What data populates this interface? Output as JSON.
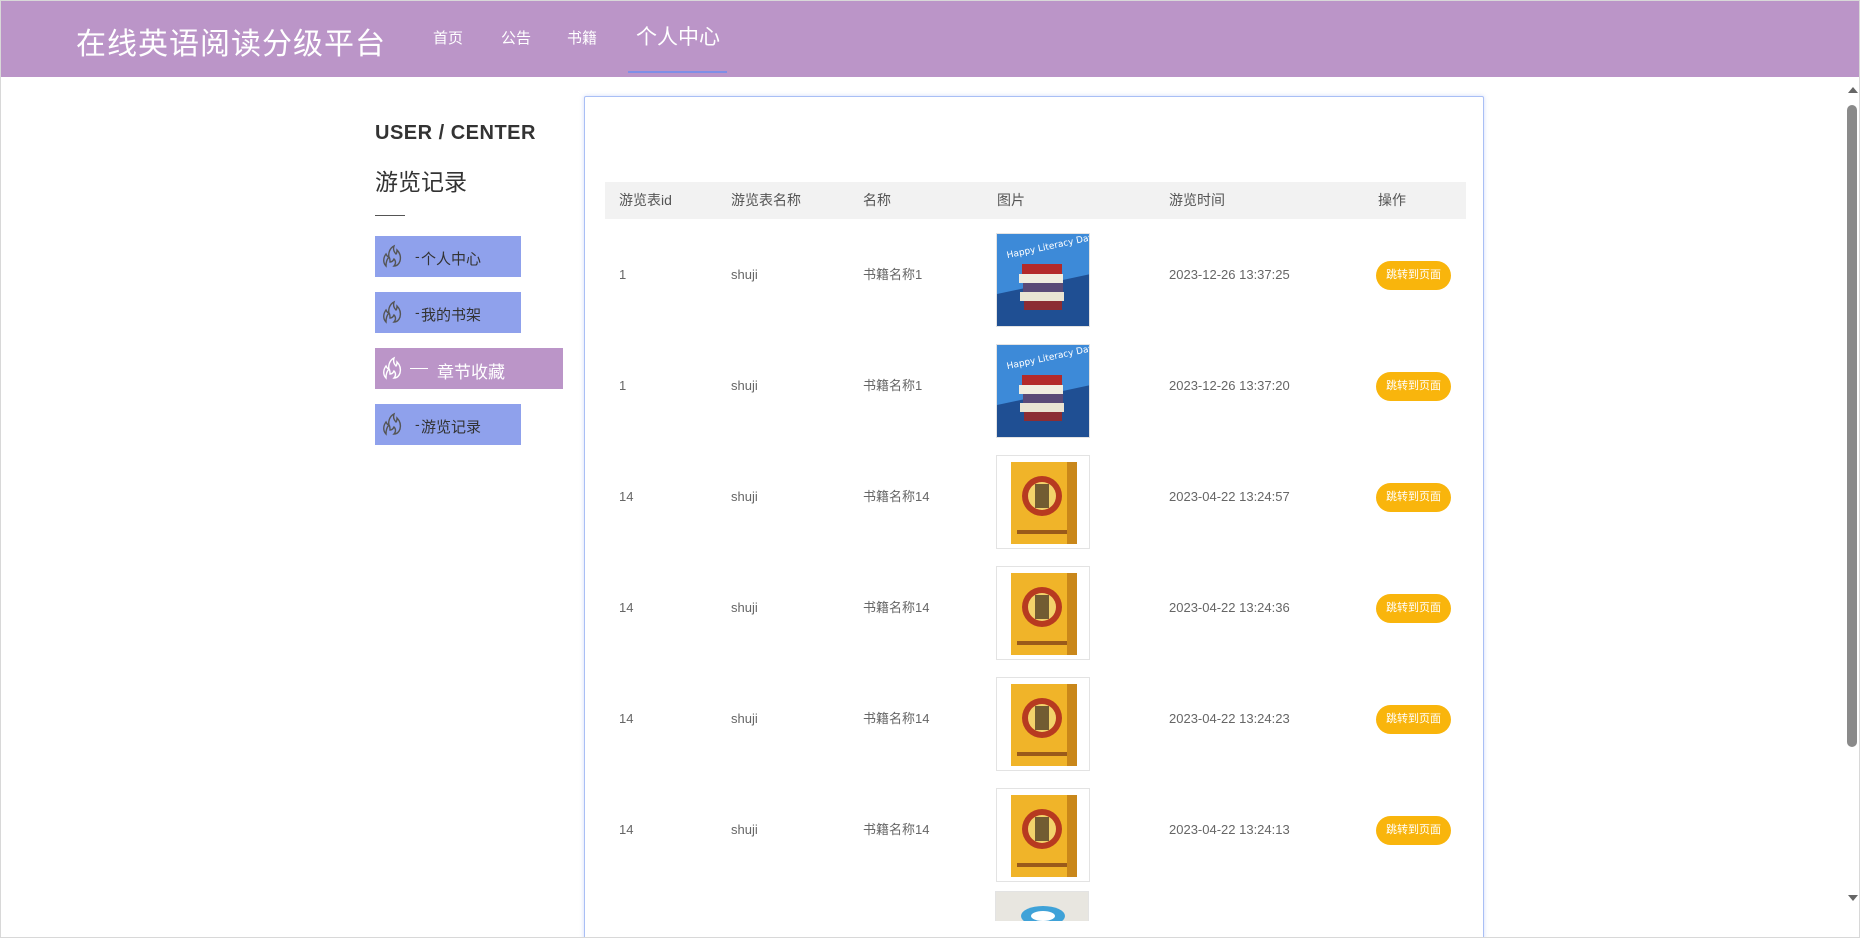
{
  "header": {
    "brand": "在线英语阅读分级平台",
    "nav": [
      {
        "label": "首页"
      },
      {
        "label": "公告"
      },
      {
        "label": "书籍"
      },
      {
        "label": "个人中心",
        "active": true
      }
    ]
  },
  "sidebar": {
    "title_en": "USER / CENTER",
    "title_cn": "游览记录",
    "items": [
      {
        "label": "个人中心",
        "icon": "fire-icon"
      },
      {
        "label": "我的书架",
        "icon": "fire-icon"
      },
      {
        "label": "章节收藏",
        "icon": "fire-icon",
        "active": true
      },
      {
        "label": "游览记录",
        "icon": "fire-icon"
      }
    ],
    "dash": "-"
  },
  "table": {
    "columns": [
      "游览表id",
      "游览表名称",
      "名称",
      "图片",
      "游览时间",
      "操作"
    ],
    "action_label": "跳转到页面",
    "rows": [
      {
        "id": "1",
        "table_name": "shuji",
        "name": "书籍名称1",
        "image": "red-book-stack",
        "time": "2023-12-26 13:37:25"
      },
      {
        "id": "1",
        "table_name": "shuji",
        "name": "书籍名称1",
        "image": "red-book-stack",
        "time": "2023-12-26 13:37:20"
      },
      {
        "id": "14",
        "table_name": "shuji",
        "name": "书籍名称14",
        "image": "yellow-book-cover",
        "time": "2023-04-22 13:24:57"
      },
      {
        "id": "14",
        "table_name": "shuji",
        "name": "书籍名称14",
        "image": "yellow-book-cover",
        "time": "2023-04-22 13:24:36"
      },
      {
        "id": "14",
        "table_name": "shuji",
        "name": "书籍名称14",
        "image": "yellow-book-cover",
        "time": "2023-04-22 13:24:23"
      },
      {
        "id": "14",
        "table_name": "shuji",
        "name": "书籍名称14",
        "image": "yellow-book-cover",
        "time": "2023-04-22 13:24:13"
      }
    ]
  },
  "colors": {
    "header_bg": "#bb95c8",
    "menu_bg": "#8fa1ec",
    "menu_active_bg": "#bb95c8",
    "button_bg": "#f9b50c",
    "panel_border": "#a9bff5"
  }
}
